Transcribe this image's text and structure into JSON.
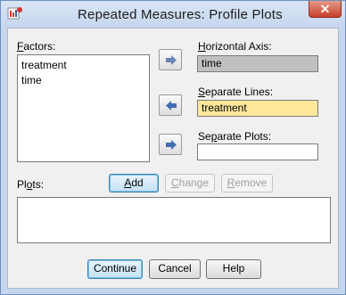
{
  "window": {
    "title": "Repeated Measures: Profile Plots",
    "close_symbol": "✕"
  },
  "factors": {
    "label_u": "F",
    "label_rest": "actors:",
    "items": [
      "treatment",
      "time"
    ]
  },
  "horizontal_axis": {
    "label_u": "H",
    "label_rest": "orizontal Axis:",
    "value": "time"
  },
  "separate_lines": {
    "label_u": "S",
    "label_rest": "eparate Lines:",
    "value": "treatment"
  },
  "separate_plots": {
    "label_pre": "Se",
    "label_u": "p",
    "label_rest": "arate Plots:",
    "value": ""
  },
  "plots": {
    "label_pre": "Pl",
    "label_u": "o",
    "label_rest": "ts:",
    "items": []
  },
  "buttons": {
    "add_u": "A",
    "add_rest": "dd",
    "change_u": "C",
    "change_rest": "hange",
    "remove_u": "R",
    "remove_rest": "emove",
    "continue": "Continue",
    "cancel": "Cancel",
    "help": "Help"
  },
  "colors": {
    "highlight_field": "#fce79a",
    "disabled_field": "#c0c0c0",
    "arrow_right": "#6a85b5",
    "arrow_left": "#3f6fb2"
  }
}
